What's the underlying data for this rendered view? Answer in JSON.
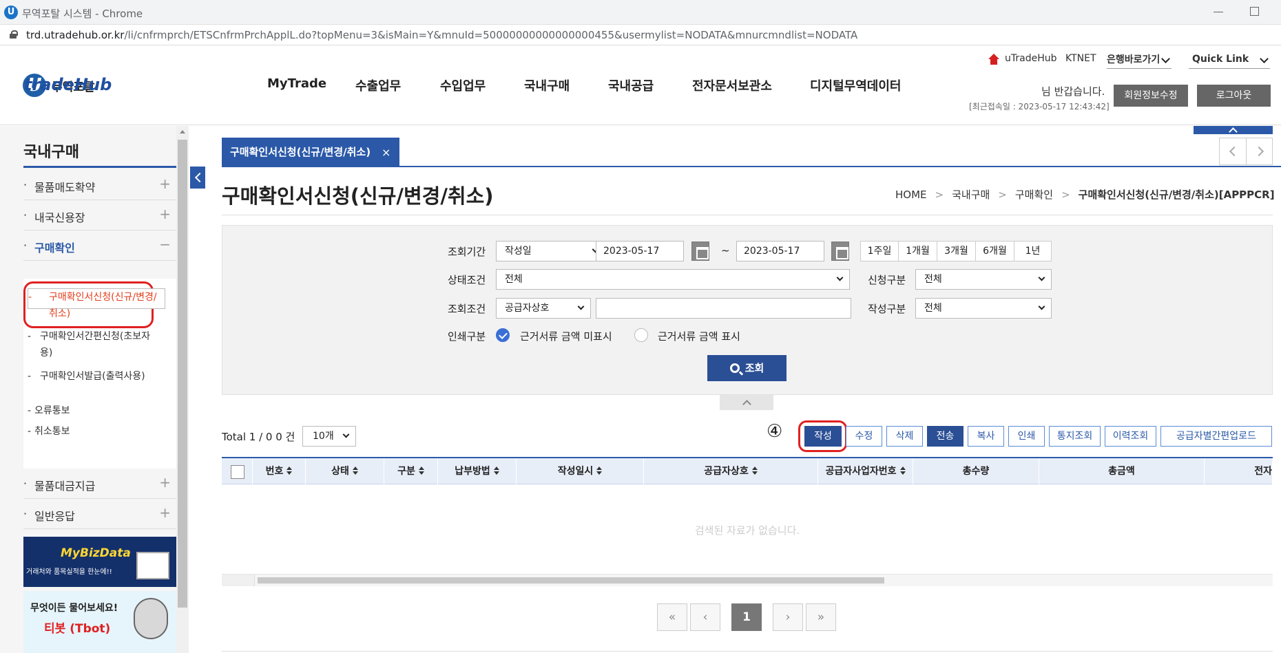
{
  "browser": {
    "window_title": "무역포탈 시스템 - Chrome",
    "url_host": "trd.utradehub.or.kr",
    "url_path": "/li/cnfrmprch/ETSCnfrmPrchApplL.do?topMenu=3&isMain=Y&mnuId=50000000000000000455&usermylist=NODATA&mnurcmndlist=NODATA"
  },
  "header": {
    "brand_u": "U",
    "brand_name": "tradeHub",
    "brand_portal": "무역포탈",
    "gnb": [
      "MyTrade",
      "수출업무",
      "수입업무",
      "국내구매",
      "국내공급",
      "전자문서보관소",
      "디지털무역데이터"
    ],
    "util_utradehub": "uTradeHub",
    "util_ktnet": "KTNET",
    "util_bank": "은행바로가기",
    "util_quicklink": "Quick Link",
    "greeting": "님 반갑습니다.",
    "last_login": "[최근접속일 : 2023-05-17 12:43:42]",
    "member_btn": "회원정보수정",
    "logout_btn": "로그아웃"
  },
  "sidebar": {
    "title": "국내구매",
    "items": [
      {
        "label": "물품매도확약",
        "toggle": "+"
      },
      {
        "label": "내국신용장",
        "toggle": "+"
      },
      {
        "label": "구매확인",
        "toggle": "−"
      },
      {
        "label": "물품대금지급",
        "toggle": "+"
      },
      {
        "label": "일반응답",
        "toggle": "+"
      }
    ],
    "bullet": "·",
    "sub_dash": "-",
    "subitems": [
      "구매확인서신청(신규/변경/취소)",
      "구매확인서간편신청(초보자용)",
      "구매확인서발급(출력사용)",
      "오류통보",
      "취소통보"
    ],
    "banner1_title": "MyBizData",
    "banner1_sub": "거래처와 품목실적을 한눈에!!",
    "banner2_title": "무엇이든 물어보세요!",
    "banner2_sub": "티봇 (Tbot)"
  },
  "tab": {
    "label": "구매확인서신청(신규/변경/취소)",
    "close": "×"
  },
  "page": {
    "title": "구매확인서신청(신규/변경/취소)",
    "breadcrumb": [
      "HOME",
      "국내구매",
      "구매확인",
      "구매확인서신청(신규/변경/취소)[APPPCR]"
    ],
    "breadcrumb_sep": ">"
  },
  "search": {
    "period_label": "조회기간",
    "period_type": "작성일",
    "date_from": "2023-05-17",
    "tilde": "~",
    "date_to": "2023-05-17",
    "period_buttons": [
      "1주일",
      "1개월",
      "3개월",
      "6개월",
      "1년"
    ],
    "status_label": "상태조건",
    "status_value": "전체",
    "apply_type_label": "신청구분",
    "apply_type_value": "전체",
    "cond_label": "조회조건",
    "cond_value": "공급자상호",
    "cond_input": "",
    "write_type_label": "작성구분",
    "write_type_value": "전체",
    "print_label": "인쇄구분",
    "print_opt1": "근거서류 금액 미표시",
    "print_opt2": "근거서류 금액 표시",
    "print_selected": 1,
    "search_btn": "조회"
  },
  "list": {
    "total_text": "Total 1 / 0   0 건",
    "page_size": "10개",
    "step_marker": "④",
    "actions": [
      "작성",
      "수정",
      "삭제",
      "전송",
      "복사",
      "인쇄",
      "통지조회",
      "이력조회",
      "공급자별간편업로드"
    ],
    "columns": [
      "번호",
      "상태",
      "구분",
      "납부방법",
      "작성일시",
      "공급자상호",
      "공급자사업자번호",
      "총수량",
      "총금액",
      "전자"
    ],
    "empty_text": "검색된 자료가 없습니다.",
    "pager": [
      "«",
      "‹",
      "1",
      "›",
      "»"
    ]
  },
  "colors": {
    "primary": "#2b59a8",
    "dark_btn": "#2b4f95",
    "highlight": "#e02020",
    "selected_sub": "#e23e1c"
  }
}
